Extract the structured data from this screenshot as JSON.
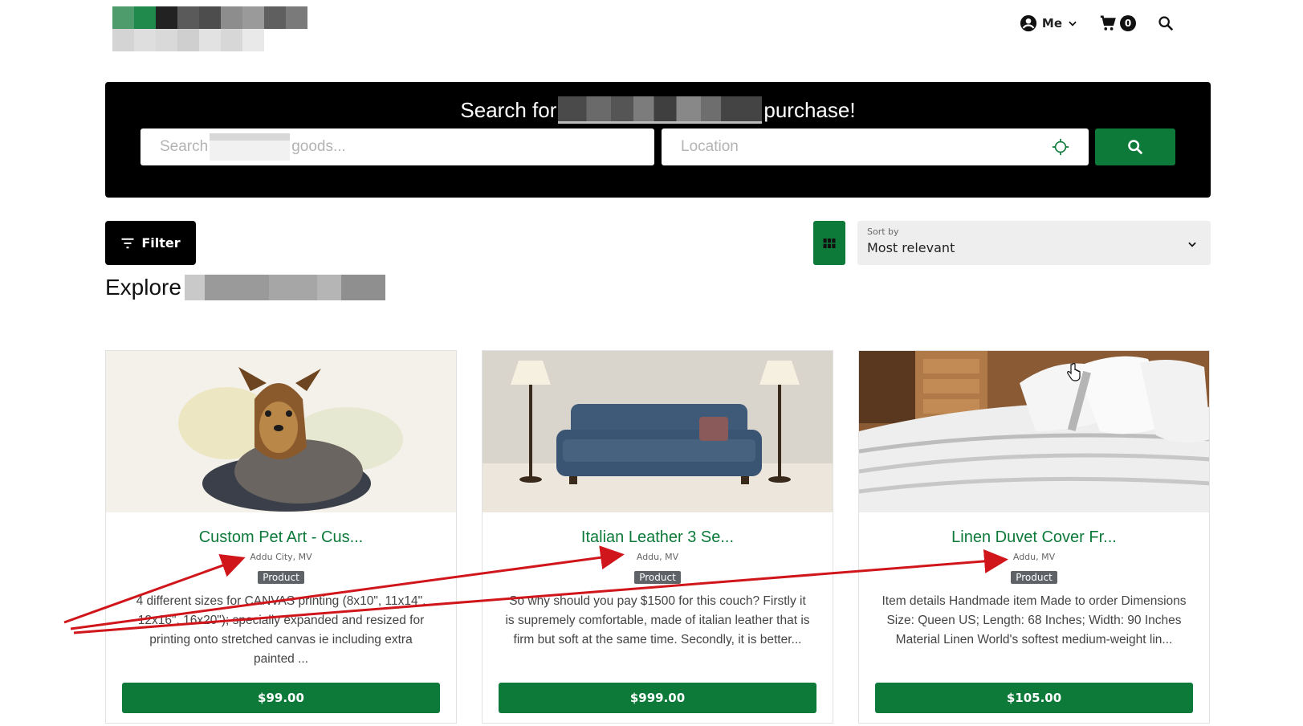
{
  "header": {
    "me_label": "Me",
    "cart_count": "0"
  },
  "hero": {
    "title_prefix": "Search for",
    "title_suffix": "purchase!",
    "search_placeholder_prefix": "Search",
    "search_placeholder_suffix": "goods...",
    "location_placeholder": "Location"
  },
  "toolbar": {
    "filter_label": "Filter",
    "sort_caption": "Sort by",
    "sort_value": "Most relevant"
  },
  "section": {
    "title": "Explore"
  },
  "colors": {
    "accent": "#0d7a3a",
    "dark": "#000000",
    "annotation_arrow": "#d0161b"
  },
  "listings": [
    {
      "title": "Custom Pet Art - Cus...",
      "location": "Addu City, MV",
      "tag": "Product",
      "description": "4 different sizes for CANVAS printing (8x10\", 11x14\", 12x16\", 16x20\"); specially expanded and resized for printing onto stretched canvas ie including extra painted ...",
      "price": "$99.00"
    },
    {
      "title": "Italian Leather 3 Se...",
      "location": "Addu, MV",
      "tag": "Product",
      "description": "So why should you pay $1500 for this couch? Firstly it is supremely comfortable, made of italian leather that is firm but soft at the same time. Secondly, it is better...",
      "price": "$999.00"
    },
    {
      "title": "Linen Duvet Cover Fr...",
      "location": "Addu, MV",
      "tag": "Product",
      "description": "Item details Handmade item Made to order Dimensions Size: Queen US; Length: 68 Inches; Width: 90 Inches Material Linen World's softest medium-weight lin...",
      "price": "$105.00"
    }
  ]
}
